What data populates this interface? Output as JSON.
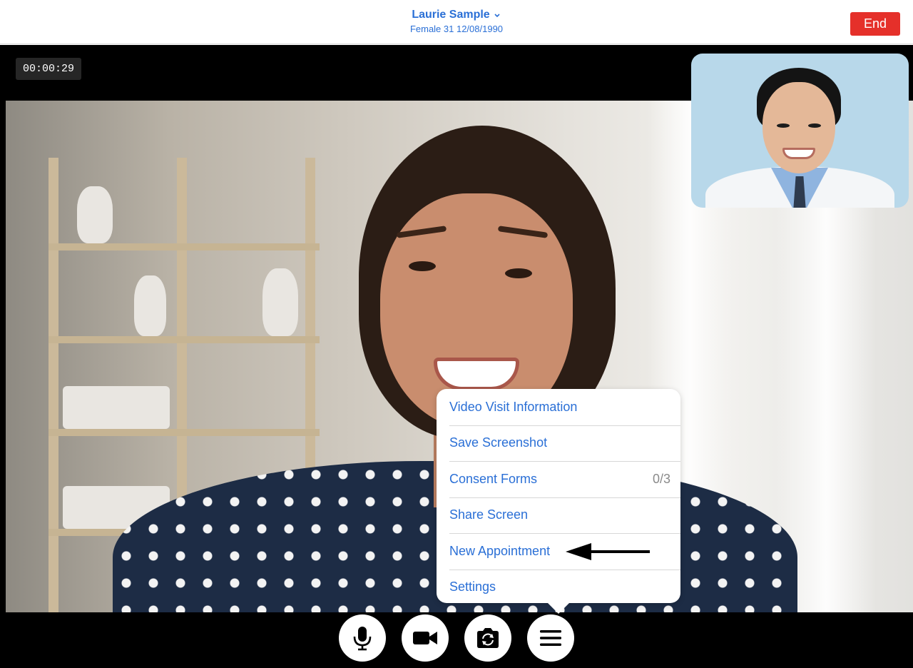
{
  "header": {
    "patient_name": "Laurie Sample",
    "patient_details": "Female 31 12/08/1990",
    "end_label": "End"
  },
  "call": {
    "timer": "00:00:29"
  },
  "menu": {
    "items": [
      {
        "label": "Video Visit Information",
        "count": ""
      },
      {
        "label": "Save Screenshot",
        "count": ""
      },
      {
        "label": "Consent Forms",
        "count": "0/3"
      },
      {
        "label": "Share Screen",
        "count": ""
      },
      {
        "label": "New Appointment",
        "count": ""
      },
      {
        "label": "Settings",
        "count": ""
      }
    ]
  },
  "controls": [
    "microphone-icon",
    "video-camera-icon",
    "switch-camera-icon",
    "menu-icon"
  ],
  "colors": {
    "accent": "#2a6fd6",
    "end_button": "#e5302a"
  }
}
